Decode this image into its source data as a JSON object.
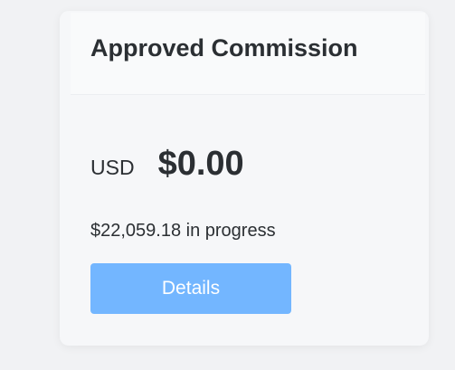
{
  "card": {
    "title": "Approved Commission",
    "currency": "USD",
    "amount": "$0.00",
    "progress_text": "$22,059.18 in progress",
    "details_label": "Details"
  },
  "colors": {
    "background": "#f1f2f4",
    "card": "#f6f7f9",
    "text": "#2b2f33",
    "button": "#73b6ff",
    "button_text": "#ffffff"
  }
}
